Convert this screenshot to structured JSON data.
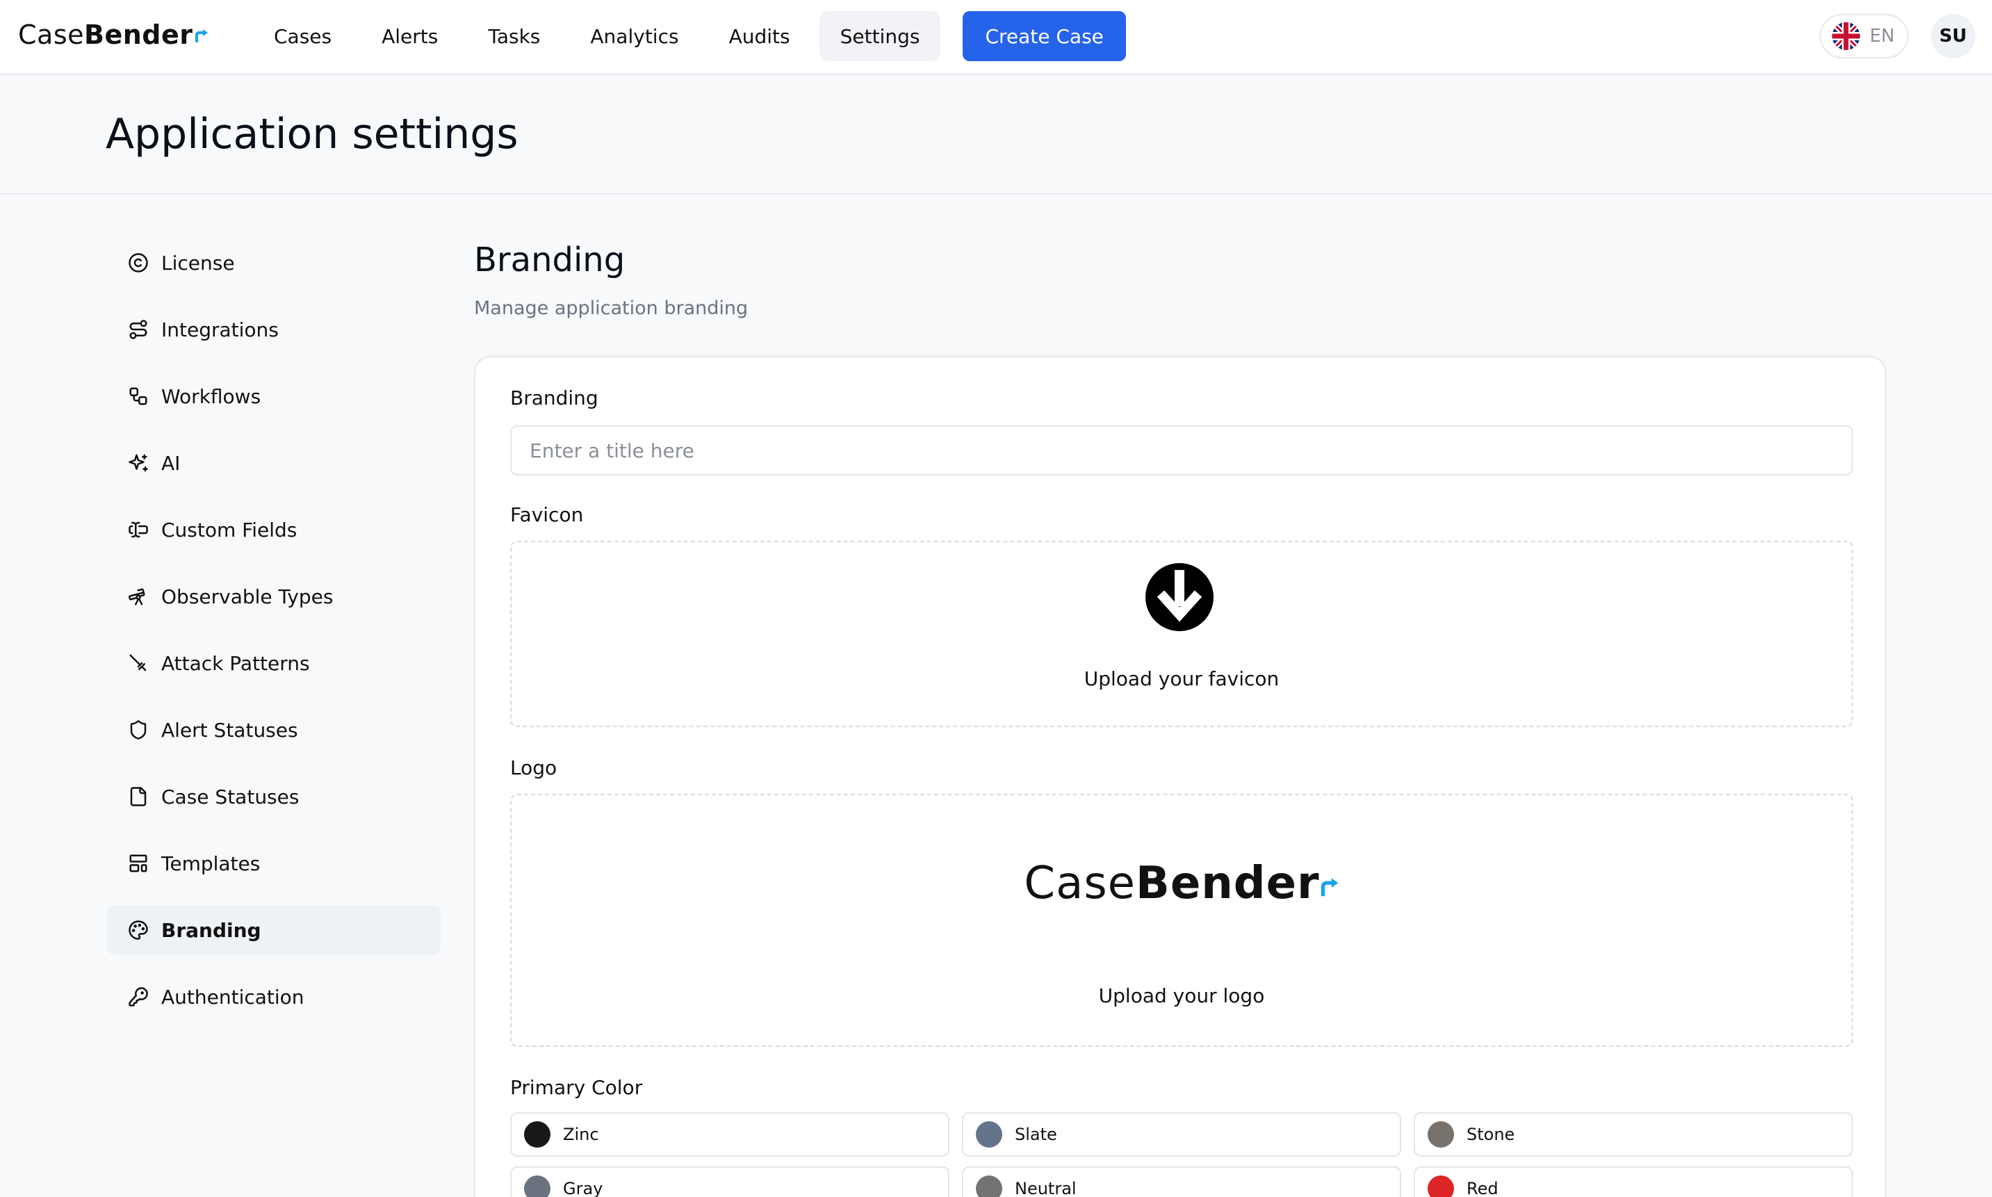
{
  "brand": {
    "light": "Case",
    "bold": "Bende",
    "tail": "r",
    "accent": "#1aa3e8"
  },
  "nav": {
    "items": [
      {
        "label": "Cases"
      },
      {
        "label": "Alerts"
      },
      {
        "label": "Tasks"
      },
      {
        "label": "Analytics"
      },
      {
        "label": "Audits"
      },
      {
        "label": "Settings",
        "active": true
      }
    ],
    "create_label": "Create Case",
    "language": "EN",
    "avatar": "SU"
  },
  "page": {
    "title": "Application settings"
  },
  "sidebar": {
    "items": [
      {
        "label": "License",
        "icon": "copyright-icon"
      },
      {
        "label": "Integrations",
        "icon": "route-icon"
      },
      {
        "label": "Workflows",
        "icon": "workflow-icon"
      },
      {
        "label": "AI",
        "icon": "sparkles-icon"
      },
      {
        "label": "Custom Fields",
        "icon": "text-cursor-input-icon"
      },
      {
        "label": "Observable Types",
        "icon": "telescope-icon"
      },
      {
        "label": "Attack Patterns",
        "icon": "sword-icon"
      },
      {
        "label": "Alert Statuses",
        "icon": "shield-icon"
      },
      {
        "label": "Case Statuses",
        "icon": "file-icon"
      },
      {
        "label": "Templates",
        "icon": "layout-template-icon"
      },
      {
        "label": "Branding",
        "icon": "palette-icon",
        "active": true
      },
      {
        "label": "Authentication",
        "icon": "key-icon"
      }
    ]
  },
  "main": {
    "title": "Branding",
    "subtitle": "Manage application branding",
    "branding_label": "Branding",
    "branding_placeholder": "Enter a title here",
    "branding_value": "",
    "favicon_label": "Favicon",
    "favicon_caption": "Upload your favicon",
    "logo_label": "Logo",
    "logo_caption": "Upload your logo",
    "primary_color_label": "Primary Color",
    "colors": [
      {
        "name": "Zinc",
        "hex": "#18181b"
      },
      {
        "name": "Slate",
        "hex": "#64748b"
      },
      {
        "name": "Stone",
        "hex": "#78716c"
      },
      {
        "name": "Gray",
        "hex": "#6b7280"
      },
      {
        "name": "Neutral",
        "hex": "#737373"
      },
      {
        "name": "Red",
        "hex": "#dc2626"
      }
    ]
  }
}
